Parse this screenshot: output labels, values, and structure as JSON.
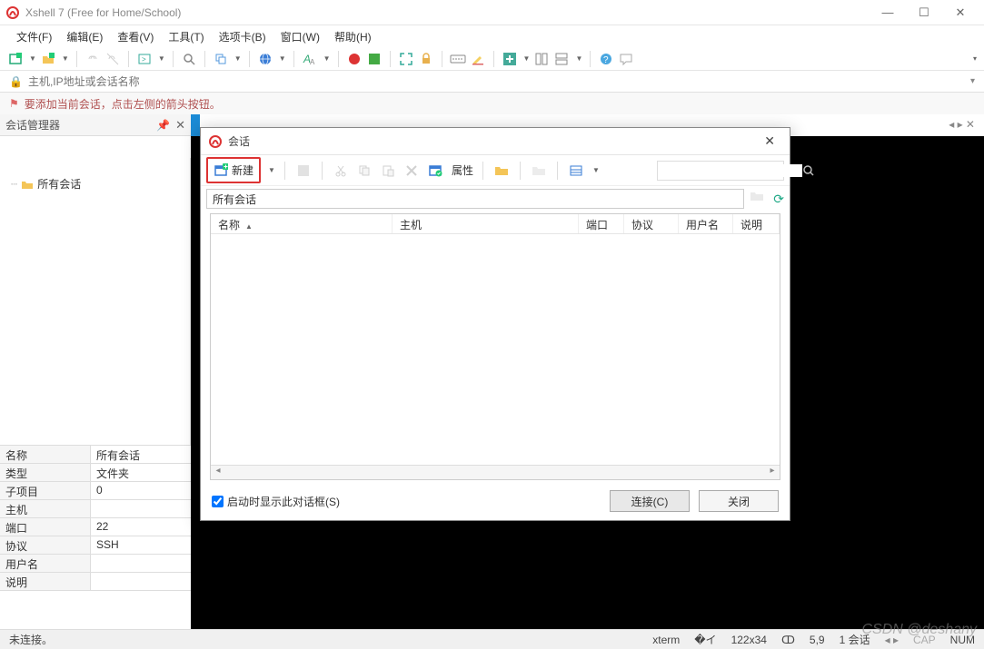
{
  "app": {
    "title": "Xshell 7 (Free for Home/School)"
  },
  "menu": {
    "file": "文件(F)",
    "edit": "编辑(E)",
    "view": "查看(V)",
    "tools": "工具(T)",
    "tab": "选项卡(B)",
    "window": "窗口(W)",
    "help": "帮助(H)"
  },
  "address": {
    "placeholder": "主机,IP地址或会话名称"
  },
  "tip": {
    "text": "要添加当前会话，点击左侧的箭头按钮。"
  },
  "session_manager": {
    "title": "会话管理器",
    "root": "所有会话"
  },
  "properties": {
    "rows": [
      {
        "k": "名称",
        "v": "所有会话"
      },
      {
        "k": "类型",
        "v": "文件夹"
      },
      {
        "k": "子项目",
        "v": "0"
      },
      {
        "k": "主机",
        "v": ""
      },
      {
        "k": "端口",
        "v": "22"
      },
      {
        "k": "协议",
        "v": "SSH"
      },
      {
        "k": "用户名",
        "v": ""
      },
      {
        "k": "说明",
        "v": ""
      }
    ]
  },
  "dialog": {
    "title": "会话",
    "new_label": "新建",
    "props_label": "属性",
    "path": "所有会话",
    "columns": {
      "name": "名称",
      "host": "主机",
      "port": "端口",
      "protocol": "协议",
      "user": "用户名",
      "desc": "说明"
    },
    "show_on_start": "启动时显示此对话框(S)",
    "connect": "连接(C)",
    "close": "关闭"
  },
  "status": {
    "conn": "未连接。",
    "term": "xterm",
    "size": "122x34",
    "pos": "5,9",
    "sess": "1 会话",
    "cap": "CAP",
    "num": "NUM"
  },
  "watermark": "CSDN @deshany"
}
